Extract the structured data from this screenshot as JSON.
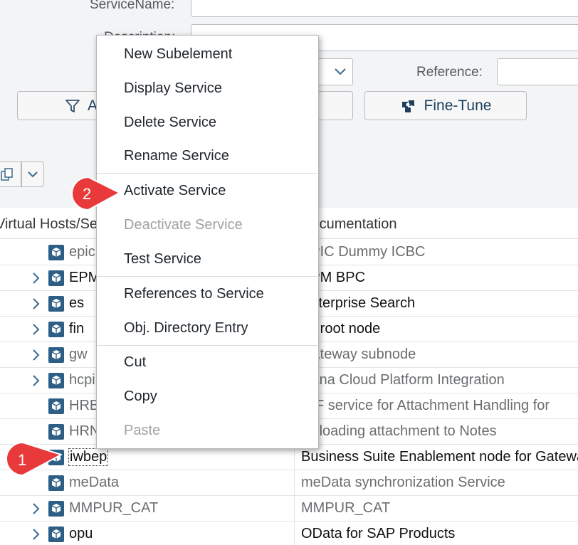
{
  "form": {
    "service_name_label": "ServiceName:",
    "description_label": "Description:",
    "reference_label": "Reference:",
    "apply_button": "Apply",
    "fine_tune_button": "Fine-Tune"
  },
  "table": {
    "headers": [
      "Virtual Hosts/Services",
      "Documentation"
    ],
    "rows": [
      {
        "name": "epic",
        "doc": "EPIC Dummy ICBC",
        "expandable": false,
        "dim": true
      },
      {
        "name": "EPM",
        "doc": "EPM BPC",
        "expandable": true,
        "dim": false
      },
      {
        "name": "es",
        "doc": "Enterprise Search",
        "expandable": true,
        "dim": false
      },
      {
        "name": "fin",
        "doc": "fin root node",
        "expandable": true,
        "dim": false
      },
      {
        "name": "gw",
        "doc": "Gateway subnode",
        "expandable": true,
        "dim": true
      },
      {
        "name": "hcpi",
        "doc": "Hana Cloud Platform Integration",
        "expandable": true,
        "dim": true
      },
      {
        "name": "HRBC",
        "doc": "ICF service for Attachment Handling for",
        "expandable": false,
        "dim": true
      },
      {
        "name": "HRN",
        "doc": "Uploading attachment to Notes",
        "expandable": false,
        "dim": true
      },
      {
        "name": "iwbep",
        "doc": "Business Suite Enablement node for Gateway",
        "expandable": false,
        "dim": false,
        "selected": true
      },
      {
        "name": "meData",
        "doc": "meData synchronization Service",
        "expandable": false,
        "dim": true
      },
      {
        "name": "MMPUR_CAT",
        "doc": "MMPUR_CAT",
        "expandable": true,
        "dim": true
      },
      {
        "name": "opu",
        "doc": "OData for SAP Products",
        "expandable": true,
        "dim": false
      }
    ]
  },
  "context_menu": {
    "items": [
      {
        "label": "New Subelement",
        "enabled": true
      },
      {
        "label": "Display Service",
        "enabled": true
      },
      {
        "label": "Delete Service",
        "enabled": true
      },
      {
        "label": "Rename Service",
        "enabled": true
      },
      {
        "label": "Activate Service",
        "enabled": true
      },
      {
        "label": "Deactivate Service",
        "enabled": false
      },
      {
        "label": "Test Service",
        "enabled": true
      },
      {
        "label": "References to Service",
        "enabled": true
      },
      {
        "label": "Obj. Directory Entry",
        "enabled": true
      },
      {
        "label": "Cut",
        "enabled": true
      },
      {
        "label": "Copy",
        "enabled": true
      },
      {
        "label": "Paste",
        "enabled": false
      }
    ]
  },
  "callouts": [
    {
      "number": "1"
    },
    {
      "number": "2"
    }
  ],
  "colors": {
    "callout": "#e8393b",
    "service_icon": "#2d5f86",
    "header_background": "#f2f4f6"
  },
  "icons": [
    "filter-icon",
    "fine-tune-icon",
    "copy-icon",
    "chevron-down-icon",
    "service-node-icon",
    "chevron-right-icon"
  ]
}
